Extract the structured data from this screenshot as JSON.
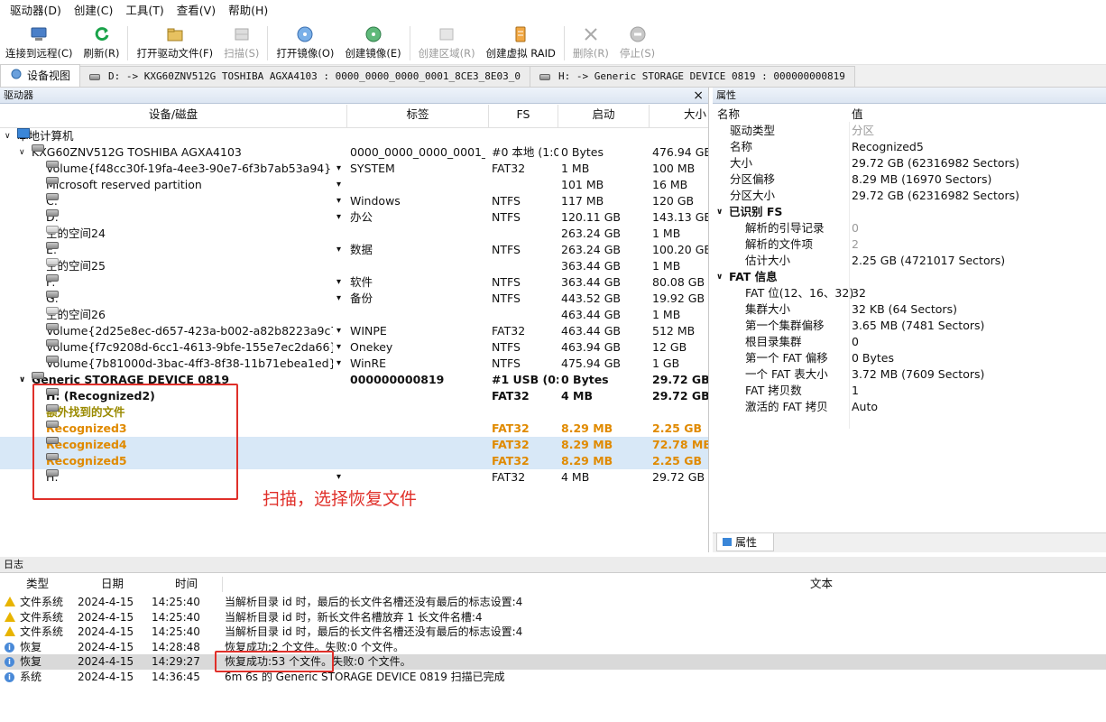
{
  "menu": [
    "驱动器(D)",
    "创建(C)",
    "工具(T)",
    "查看(V)",
    "帮助(H)"
  ],
  "toolbar": [
    {
      "label": "连接到远程(C)",
      "icon": "remote-connect-icon",
      "enabled": true
    },
    {
      "label": "刷新(R)",
      "icon": "refresh-icon",
      "enabled": true
    },
    {
      "label": "打开驱动文件(F)",
      "icon": "open-drive-file-icon",
      "enabled": true
    },
    {
      "label": "扫描(S)",
      "icon": "scan-icon",
      "enabled": false
    },
    {
      "label": "打开镜像(O)",
      "icon": "open-image-icon",
      "enabled": true
    },
    {
      "label": "创建镜像(E)",
      "icon": "create-image-icon",
      "enabled": true
    },
    {
      "label": "创建区域(R)",
      "icon": "create-region-icon",
      "enabled": false
    },
    {
      "label": "创建虚拟 RAID",
      "icon": "virtual-raid-icon",
      "enabled": true
    },
    {
      "label": "删除(R)",
      "icon": "delete-icon",
      "enabled": false
    },
    {
      "label": "停止(S)",
      "icon": "stop-icon",
      "enabled": false
    }
  ],
  "tabs": [
    {
      "label": "设备视图",
      "active": true
    },
    {
      "label": "D: -> KXG60ZNV512G TOSHIBA AGXA4103 : 0000_0000_0000_0001_8CE3_8E03_0",
      "active": false
    },
    {
      "label": "H: -> Generic STORAGE DEVICE 0819 : 000000000819",
      "active": false
    }
  ],
  "drives": {
    "title": "驱动器",
    "close": "×",
    "columns": [
      "设备/磁盘",
      "标签",
      "FS",
      "启动",
      "大小"
    ],
    "rows": [
      {
        "indent": 0,
        "caret": "∨",
        "icon": "pc",
        "name": "本地计算机",
        "label": "",
        "fs": "",
        "start": "",
        "size": "",
        "style": ""
      },
      {
        "indent": 1,
        "caret": "∨",
        "icon": "disk",
        "name": "KXG60ZNV512G TOSHIBA AGXA4103",
        "label": "0000_0000_0000_0001_...",
        "fs": "#0 本地 (1:0)",
        "start": "0 Bytes",
        "size": "476.94 GB",
        "style": ""
      },
      {
        "indent": 2,
        "caret": "",
        "icon": "disk",
        "name": "Volume{f48cc30f-19fa-4ee3-90e7-6f3b7ab53a94}",
        "dd": true,
        "label": "SYSTEM",
        "fs": "FAT32",
        "start": "1 MB",
        "size": "100 MB",
        "style": ""
      },
      {
        "indent": 2,
        "caret": "",
        "icon": "disk",
        "name": "Microsoft reserved partition",
        "dd": true,
        "label": "",
        "fs": "",
        "start": "101 MB",
        "size": "16 MB",
        "style": ""
      },
      {
        "indent": 2,
        "caret": "",
        "icon": "disk",
        "name": "C:",
        "dd": true,
        "label": "Windows",
        "fs": "NTFS",
        "start": "117 MB",
        "size": "120 GB",
        "style": ""
      },
      {
        "indent": 2,
        "caret": "",
        "icon": "disk",
        "name": "D:",
        "dd": true,
        "label": "办公",
        "fs": "NTFS",
        "start": "120.11 GB",
        "size": "143.13 GB",
        "style": ""
      },
      {
        "indent": 2,
        "caret": "",
        "icon": "disk-light",
        "name": "空的空间24",
        "label": "",
        "fs": "",
        "start": "263.24 GB",
        "size": "1 MB",
        "style": ""
      },
      {
        "indent": 2,
        "caret": "",
        "icon": "disk",
        "name": "E:",
        "dd": true,
        "label": "数据",
        "fs": "NTFS",
        "start": "263.24 GB",
        "size": "100.20 GB",
        "style": ""
      },
      {
        "indent": 2,
        "caret": "",
        "icon": "disk-light",
        "name": "空的空间25",
        "label": "",
        "fs": "",
        "start": "363.44 GB",
        "size": "1 MB",
        "style": ""
      },
      {
        "indent": 2,
        "caret": "",
        "icon": "disk",
        "name": "F:",
        "dd": true,
        "label": "软件",
        "fs": "NTFS",
        "start": "363.44 GB",
        "size": "80.08 GB",
        "style": ""
      },
      {
        "indent": 2,
        "caret": "",
        "icon": "disk",
        "name": "G:",
        "dd": true,
        "label": "备份",
        "fs": "NTFS",
        "start": "443.52 GB",
        "size": "19.92 GB",
        "style": ""
      },
      {
        "indent": 2,
        "caret": "",
        "icon": "disk-light",
        "name": "空的空间26",
        "label": "",
        "fs": "",
        "start": "463.44 GB",
        "size": "1 MB",
        "style": ""
      },
      {
        "indent": 2,
        "caret": "",
        "icon": "disk",
        "name": "Volume{2d25e8ec-d657-423a-b002-a82b8223a9c7}",
        "dd": true,
        "label": "WINPE",
        "fs": "FAT32",
        "start": "463.44 GB",
        "size": "512 MB",
        "style": ""
      },
      {
        "indent": 2,
        "caret": "",
        "icon": "disk",
        "name": "Volume{f7c9208d-6cc1-4613-9bfe-155e7ec2da66}",
        "dd": true,
        "label": "Onekey",
        "fs": "NTFS",
        "start": "463.94 GB",
        "size": "12 GB",
        "style": ""
      },
      {
        "indent": 2,
        "caret": "",
        "icon": "disk",
        "name": "Volume{7b81000d-3bac-4ff3-8f38-11b71ebea1ed}",
        "dd": true,
        "label": "WinRE",
        "fs": "NTFS",
        "start": "475.94 GB",
        "size": "1 GB",
        "style": ""
      },
      {
        "indent": 1,
        "caret": "∨",
        "icon": "disk",
        "name": "Generic STORAGE DEVICE 0819",
        "label": "000000000819",
        "fs": "#1 USB (0:...",
        "start": "0 Bytes",
        "size": "29.72 GB",
        "style": "bold"
      },
      {
        "indent": 2,
        "caret": "",
        "icon": "disk",
        "name": "H: (Recognized2)",
        "label": "",
        "fs": "FAT32",
        "start": "4 MB",
        "size": "29.72 GB",
        "style": "bold"
      },
      {
        "indent": 2,
        "caret": "",
        "icon": "disk",
        "name": "额外找到的文件",
        "label": "",
        "fs": "",
        "start": "",
        "size": "",
        "style": "olive"
      },
      {
        "indent": 2,
        "caret": "",
        "icon": "disk",
        "name": "Recognized3",
        "label": "",
        "fs": "FAT32",
        "start": "8.29 MB",
        "size": "2.25 GB",
        "style": "orange"
      },
      {
        "indent": 2,
        "caret": "",
        "icon": "disk",
        "name": "Recognized4",
        "label": "",
        "fs": "FAT32",
        "start": "8.29 MB",
        "size": "72.78 MB",
        "style": "orange sel"
      },
      {
        "indent": 2,
        "caret": "",
        "icon": "disk",
        "name": "Recognized5",
        "label": "",
        "fs": "FAT32",
        "start": "8.29 MB",
        "size": "2.25 GB",
        "style": "orange sel"
      },
      {
        "indent": 2,
        "caret": "",
        "icon": "disk",
        "name": "H:",
        "dd": true,
        "label": "",
        "fs": "FAT32",
        "start": "4 MB",
        "size": "29.72 GB",
        "style": ""
      }
    ]
  },
  "annotation": "扫描，选择恢复文件",
  "properties": {
    "title": "属性",
    "col_name": "名称",
    "col_value": "值",
    "rows": [
      {
        "k": "驱动类型",
        "v": "分区",
        "level": 1,
        "grey": true
      },
      {
        "k": "名称",
        "v": "Recognized5",
        "level": 1
      },
      {
        "k": "大小",
        "v": "29.72 GB (62316982 Sectors)",
        "level": 1
      },
      {
        "k": "分区偏移",
        "v": "8.29 MB (16970 Sectors)",
        "level": 1
      },
      {
        "k": "分区大小",
        "v": "29.72 GB (62316982 Sectors)",
        "level": 1
      },
      {
        "k": "已识别 FS",
        "v": "",
        "group": true
      },
      {
        "k": "解析的引导记录",
        "v": "0",
        "level": 2,
        "grey": true
      },
      {
        "k": "解析的文件项",
        "v": "2",
        "level": 2,
        "grey": true
      },
      {
        "k": "估计大小",
        "v": "2.25 GB (4721017 Sectors)",
        "level": 2
      },
      {
        "k": "FAT 信息",
        "v": "",
        "group": true
      },
      {
        "k": "FAT 位(12、16、32)",
        "v": "32",
        "level": 2
      },
      {
        "k": "集群大小",
        "v": "32 KB (64 Sectors)",
        "level": 2
      },
      {
        "k": "第一个集群偏移",
        "v": "3.65 MB (7481 Sectors)",
        "level": 2
      },
      {
        "k": "根目录集群",
        "v": "0",
        "level": 2
      },
      {
        "k": "第一个 FAT 偏移",
        "v": "0 Bytes",
        "level": 2
      },
      {
        "k": "一个 FAT 表大小",
        "v": "3.72 MB (7609 Sectors)",
        "level": 2
      },
      {
        "k": "FAT 拷贝数",
        "v": "1",
        "level": 2
      },
      {
        "k": "激活的 FAT 拷贝",
        "v": "Auto",
        "level": 2
      }
    ],
    "tab_label": "属性"
  },
  "log": {
    "title": "日志",
    "columns": [
      "类型",
      "日期",
      "时间",
      "文本"
    ],
    "rows": [
      {
        "icon": "warn",
        "type": "文件系统",
        "date": "2024-4-15",
        "time": "14:25:40",
        "text": "当解析目录 id 时，最后的长文件名槽还没有最后的标志设置:4"
      },
      {
        "icon": "warn",
        "type": "文件系统",
        "date": "2024-4-15",
        "time": "14:25:40",
        "text": "当解析目录 id 时，新长文件名槽放弃 1 长文件名槽:4"
      },
      {
        "icon": "warn",
        "type": "文件系统",
        "date": "2024-4-15",
        "time": "14:25:40",
        "text": "当解析目录 id 时，最后的长文件名槽还没有最后的标志设置:4"
      },
      {
        "icon": "info",
        "type": "恢复",
        "date": "2024-4-15",
        "time": "14:28:48",
        "text": "恢复成功:2 个文件。失败:0 个文件。"
      },
      {
        "icon": "info",
        "type": "恢复",
        "date": "2024-4-15",
        "time": "14:29:27",
        "text": "恢复成功:53 个文件。失败:0 个文件。",
        "sel": true
      },
      {
        "icon": "info",
        "type": "系统",
        "date": "2024-4-15",
        "time": "14:36:45",
        "text": "6m 6s 的 Generic STORAGE DEVICE 0819 扫描已完成"
      }
    ]
  },
  "colors": {
    "accent_red": "#e0302a",
    "orange": "#e08a00",
    "selection": "#d8e8f7"
  }
}
